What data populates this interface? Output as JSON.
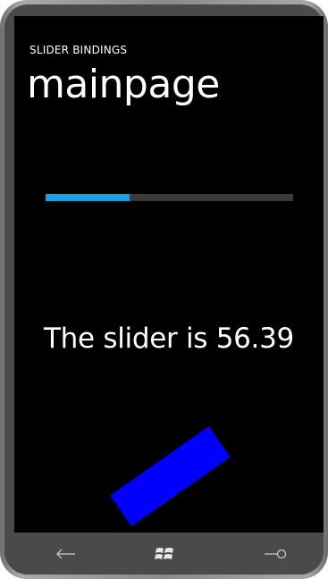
{
  "app": {
    "title": "SLIDER BINDINGS",
    "page_title": "mainpage"
  },
  "slider": {
    "value": 56.39,
    "min": 0,
    "max": 100,
    "accent_color": "#1ba1e2",
    "track_color": "#3a3a3a",
    "fraction_fill": 0.34
  },
  "status": {
    "text": "The slider is 56.39"
  },
  "rectangle": {
    "color": "#0000ff",
    "rotation_degrees": -35
  },
  "hardware_buttons": {
    "back_icon": "back-arrow-icon",
    "start_icon": "windows-logo-icon",
    "search_icon": "search-icon"
  }
}
